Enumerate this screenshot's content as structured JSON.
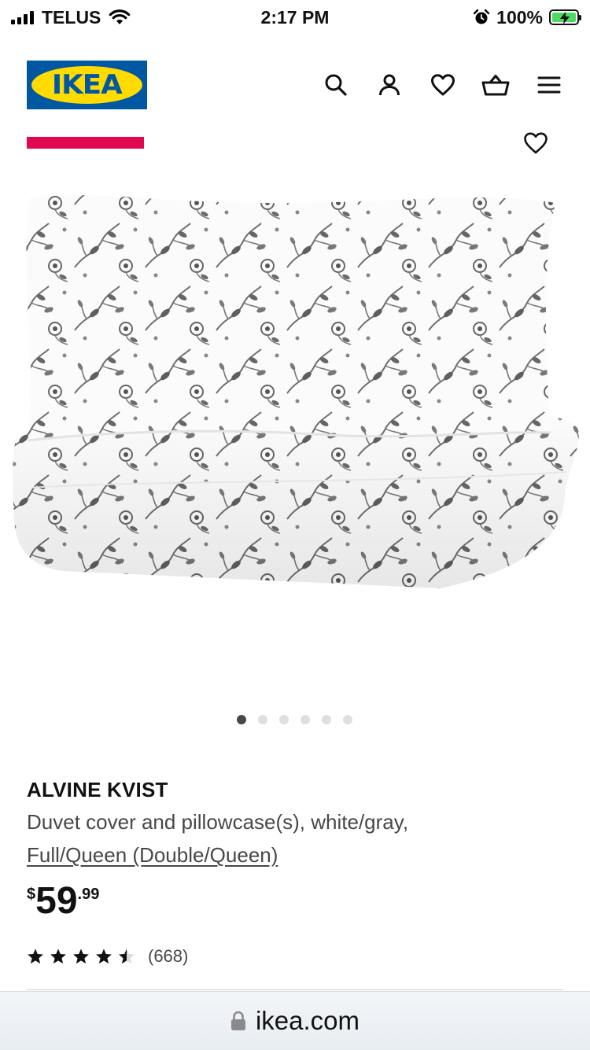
{
  "status_bar": {
    "carrier": "TELUS",
    "time": "2:17 PM",
    "battery": "100%",
    "icons": [
      "signal-bars-icon",
      "wifi-icon",
      "alarm-icon",
      "battery-charging-icon"
    ]
  },
  "header": {
    "logo_text": "IKEA",
    "icons": [
      "search-icon",
      "account-icon",
      "heart-icon",
      "cart-icon",
      "menu-icon"
    ],
    "colors": {
      "ikea_blue": "#0058a3",
      "ikea_yellow": "#ffdb00"
    }
  },
  "media": {
    "badge_color": "#e00751",
    "carousel": {
      "count": 6,
      "active_index": 0
    }
  },
  "product": {
    "name": "ALVINE KVIST",
    "description": "Duvet cover and pillowcase(s), white/gray,",
    "size": "Full/Queen (Double/Queen)",
    "price": {
      "currency": "$",
      "integer": "59",
      "decimal": ".99"
    },
    "rating": {
      "stars": 4.5,
      "max": 5,
      "review_count": "(668)"
    }
  },
  "browser": {
    "url": "ikea.com",
    "icons": [
      "lock-icon"
    ]
  }
}
